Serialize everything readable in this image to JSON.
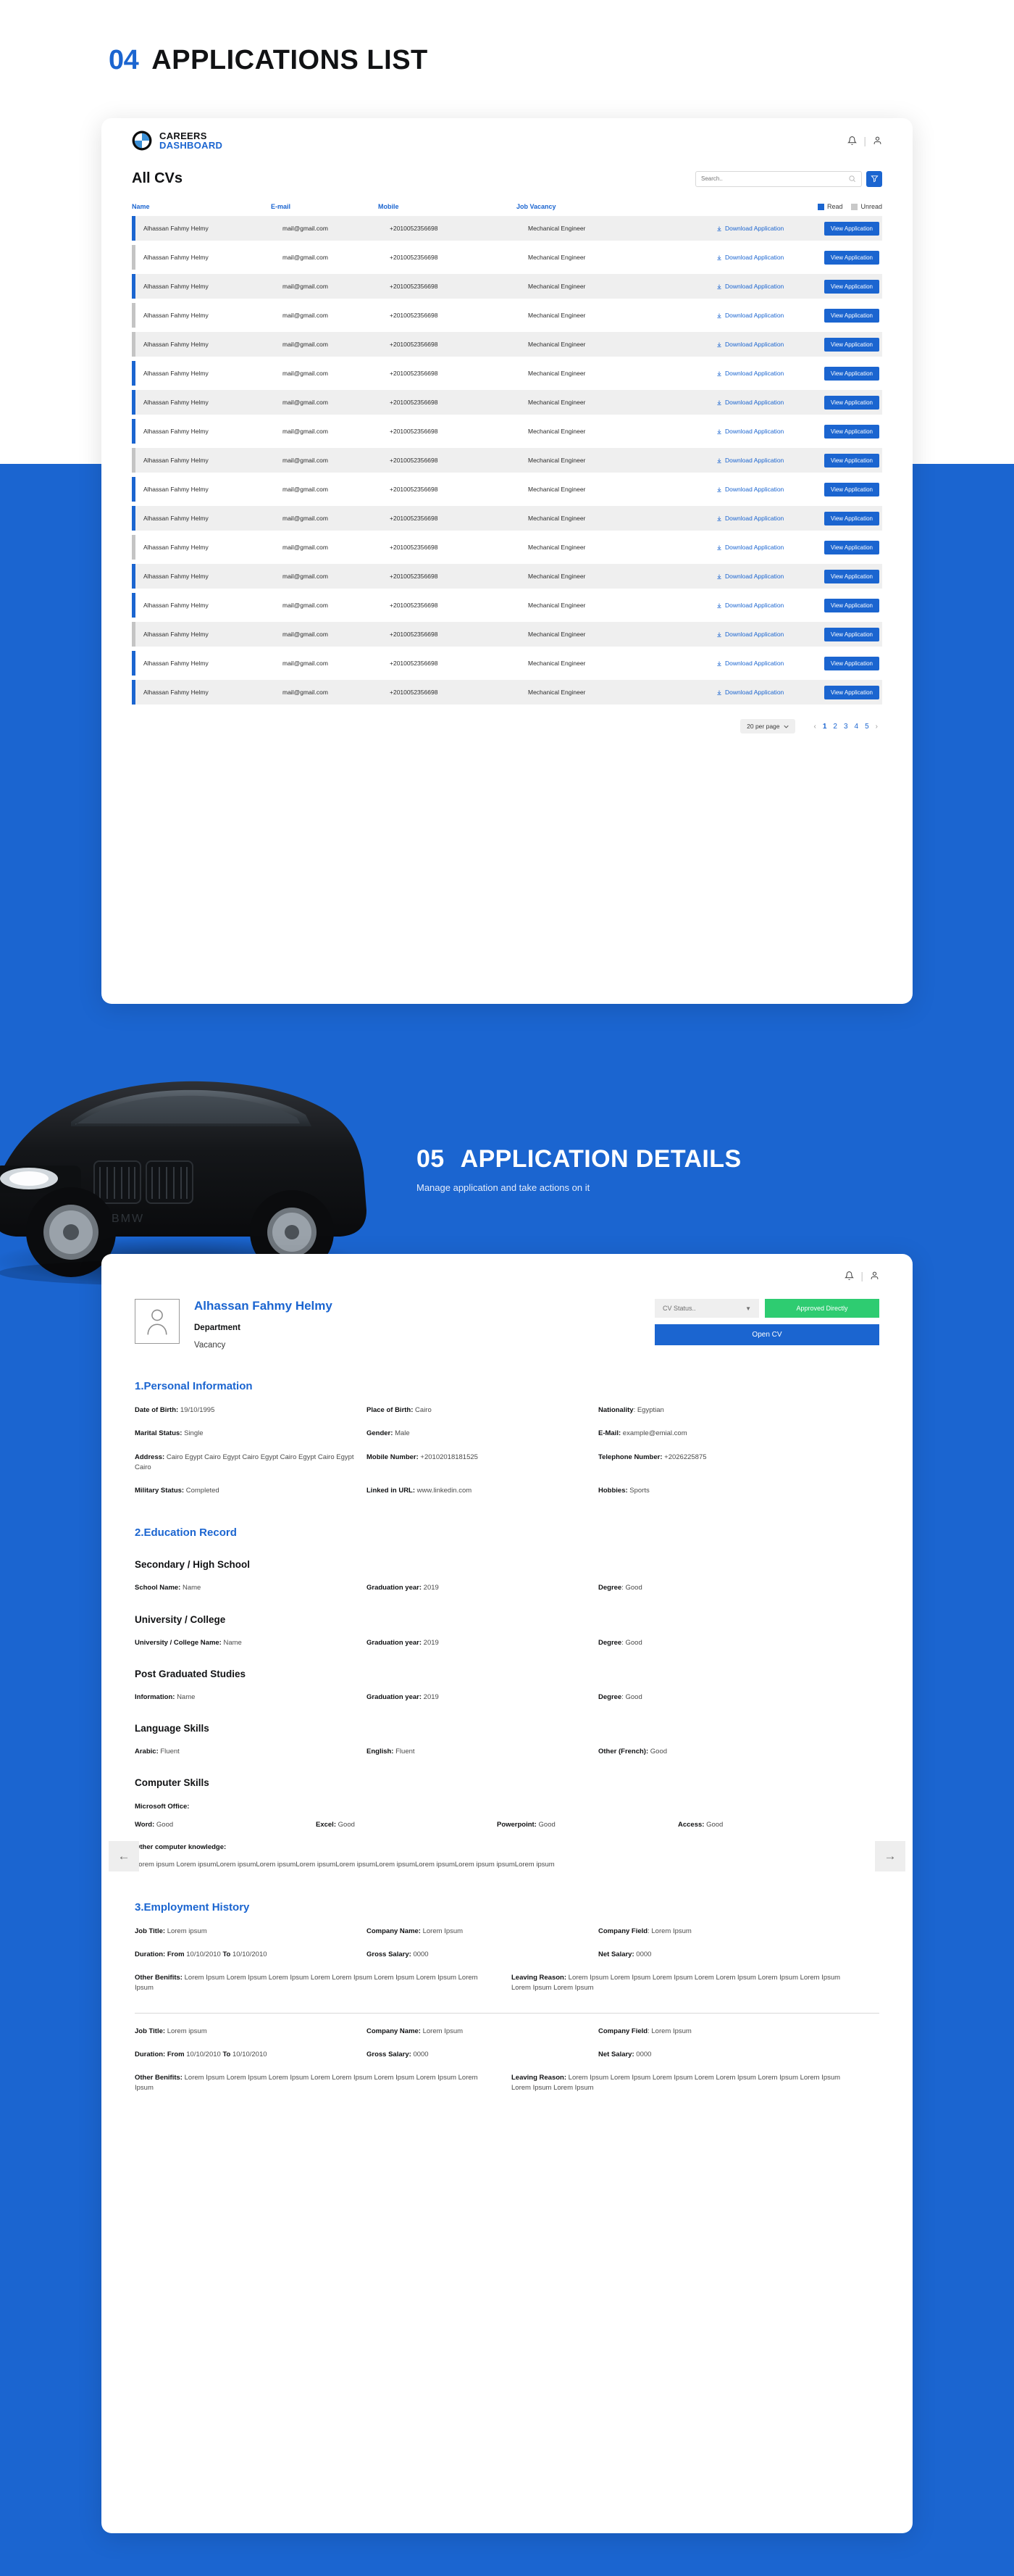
{
  "colors": {
    "brand_blue": "#1B65D0",
    "green": "#2ECC71",
    "gray_row": "#efefef",
    "unread": "#c4c4c4"
  },
  "section04": {
    "number": "04",
    "title": "APPLICATIONS LIST"
  },
  "dashboard": {
    "brand": {
      "careers": "CAREERS",
      "dashboard": "DASHBOARD"
    },
    "icons": {
      "bell": "bell-icon",
      "user": "user-icon"
    },
    "list_title": "All CVs",
    "search": {
      "placeholder": "Search..",
      "value": ""
    },
    "filter_label": "filter-icon",
    "columns": [
      "Name",
      "E-mail",
      "Mobile",
      "Job Vacancy"
    ],
    "legend": {
      "read": "Read",
      "unread": "Unread"
    },
    "row_actions": {
      "download": "Download Application",
      "view": "View Application"
    },
    "rows": [
      {
        "name": "Alhassan Fahmy Helmy",
        "email": "mail@gmail.com",
        "mobile": "+2010052356698",
        "vacancy": "Mechanical Engineer",
        "state": "read",
        "shade": "alt"
      },
      {
        "name": "Alhassan Fahmy Helmy",
        "email": "mail@gmail.com",
        "mobile": "+2010052356698",
        "vacancy": "Mechanical Engineer",
        "state": "unread",
        "shade": "plain"
      },
      {
        "name": "Alhassan Fahmy Helmy",
        "email": "mail@gmail.com",
        "mobile": "+2010052356698",
        "vacancy": "Mechanical Engineer",
        "state": "read",
        "shade": "alt"
      },
      {
        "name": "Alhassan Fahmy Helmy",
        "email": "mail@gmail.com",
        "mobile": "+2010052356698",
        "vacancy": "Mechanical Engineer",
        "state": "unread",
        "shade": "plain"
      },
      {
        "name": "Alhassan Fahmy Helmy",
        "email": "mail@gmail.com",
        "mobile": "+2010052356698",
        "vacancy": "Mechanical Engineer",
        "state": "unread",
        "shade": "alt"
      },
      {
        "name": "Alhassan Fahmy Helmy",
        "email": "mail@gmail.com",
        "mobile": "+2010052356698",
        "vacancy": "Mechanical Engineer",
        "state": "read",
        "shade": "plain"
      },
      {
        "name": "Alhassan Fahmy Helmy",
        "email": "mail@gmail.com",
        "mobile": "+2010052356698",
        "vacancy": "Mechanical Engineer",
        "state": "read",
        "shade": "alt"
      },
      {
        "name": "Alhassan Fahmy Helmy",
        "email": "mail@gmail.com",
        "mobile": "+2010052356698",
        "vacancy": "Mechanical Engineer",
        "state": "read",
        "shade": "plain"
      },
      {
        "name": "Alhassan Fahmy Helmy",
        "email": "mail@gmail.com",
        "mobile": "+2010052356698",
        "vacancy": "Mechanical Engineer",
        "state": "unread",
        "shade": "alt"
      },
      {
        "name": "Alhassan Fahmy Helmy",
        "email": "mail@gmail.com",
        "mobile": "+2010052356698",
        "vacancy": "Mechanical Engineer",
        "state": "read",
        "shade": "plain"
      },
      {
        "name": "Alhassan Fahmy Helmy",
        "email": "mail@gmail.com",
        "mobile": "+2010052356698",
        "vacancy": "Mechanical Engineer",
        "state": "read",
        "shade": "alt"
      },
      {
        "name": "Alhassan Fahmy Helmy",
        "email": "mail@gmail.com",
        "mobile": "+2010052356698",
        "vacancy": "Mechanical Engineer",
        "state": "unread",
        "shade": "plain"
      },
      {
        "name": "Alhassan Fahmy Helmy",
        "email": "mail@gmail.com",
        "mobile": "+2010052356698",
        "vacancy": "Mechanical Engineer",
        "state": "read",
        "shade": "alt"
      },
      {
        "name": "Alhassan Fahmy Helmy",
        "email": "mail@gmail.com",
        "mobile": "+2010052356698",
        "vacancy": "Mechanical Engineer",
        "state": "read",
        "shade": "plain"
      },
      {
        "name": "Alhassan Fahmy Helmy",
        "email": "mail@gmail.com",
        "mobile": "+2010052356698",
        "vacancy": "Mechanical Engineer",
        "state": "unread",
        "shade": "alt"
      },
      {
        "name": "Alhassan Fahmy Helmy",
        "email": "mail@gmail.com",
        "mobile": "+2010052356698",
        "vacancy": "Mechanical Engineer",
        "state": "read",
        "shade": "plain"
      },
      {
        "name": "Alhassan Fahmy Helmy",
        "email": "mail@gmail.com",
        "mobile": "+2010052356698",
        "vacancy": "Mechanical Engineer",
        "state": "read",
        "shade": "alt"
      }
    ],
    "pagination": {
      "per_page": "20 per page",
      "prev": "‹",
      "next": "›",
      "pages": [
        "1",
        "2",
        "3",
        "4",
        "5"
      ],
      "current": "1"
    }
  },
  "section05": {
    "number": "05",
    "title": "APPLICATION DETAILS",
    "subtitle": "Manage application and take actions on it"
  },
  "details": {
    "icons": {
      "bell": "bell-icon",
      "user": "user-icon"
    },
    "candidate_name": "Alhassan Fahmy Helmy",
    "department_label": "Department",
    "vacancy_label": "Vacancy",
    "cv_status": "CV Status..",
    "approve_button": "Approved Directly",
    "open_cv_button": "Open CV",
    "nav": {
      "prev": "←",
      "next": "→"
    },
    "personal": {
      "title": "1.Personal Information",
      "fields": [
        {
          "k": "Date of Birth:",
          "v": "19/10/1995"
        },
        {
          "k": "Place of Birth:",
          "v": "Cairo"
        },
        {
          "k": "Nationality",
          "v": ": Egyptian"
        },
        {
          "k": "Marital Status:",
          "v": "Single"
        },
        {
          "k": "Gender:",
          "v": "Male"
        },
        {
          "k": "E-Mail:",
          "v": "example@emial.com"
        },
        {
          "k": "Address:",
          "v": "Cairo Egypt Cairo Egypt Cairo Egypt Cairo Egypt Cairo Egypt Cairo"
        },
        {
          "k": "Mobile Number:",
          "v": "+20102018181525"
        },
        {
          "k": "Telephone Number:",
          "v": "+2026225875"
        },
        {
          "k": "Military Status:",
          "v": "Completed"
        },
        {
          "k": "Linked in URL:",
          "v": "www.linkedin.com"
        },
        {
          "k": "Hobbies:",
          "v": "Sports"
        }
      ]
    },
    "education": {
      "title": "2.Education Record",
      "blocks": [
        {
          "heading": "Secondary / High School",
          "fields": [
            {
              "k": "School Name:",
              "v": "Name"
            },
            {
              "k": "Graduation year:",
              "v": "2019"
            },
            {
              "k": "Degree",
              "v": ": Good"
            }
          ]
        },
        {
          "heading": "University / College",
          "fields": [
            {
              "k": "University / College Name:",
              "v": "Name"
            },
            {
              "k": "Graduation year:",
              "v": "2019"
            },
            {
              "k": "Degree",
              "v": ": Good"
            }
          ]
        },
        {
          "heading": "Post Graduated Studies",
          "fields": [
            {
              "k": "Information:",
              "v": "Name"
            },
            {
              "k": "Graduation year:",
              "v": "2019"
            },
            {
              "k": "Degree",
              "v": ": Good"
            }
          ]
        }
      ],
      "language": {
        "heading": "Language Skills",
        "fields": [
          {
            "k": "Arabic:",
            "v": "Fluent"
          },
          {
            "k": "English:",
            "v": "Fluent"
          },
          {
            "k": "Other (French):",
            "v": "Good"
          }
        ]
      },
      "computer": {
        "heading": "Computer Skills",
        "office_label": "Microsoft Office:",
        "office": [
          {
            "k": "Word:",
            "v": "Good"
          },
          {
            "k": "Excel:",
            "v": "Good"
          },
          {
            "k": "Powerpoint:",
            "v": "Good"
          },
          {
            "k": "Access:",
            "v": "Good"
          }
        ],
        "other_label": "Other computer knowledge:",
        "other_text": "Lorem ipsum Lorem ipsumLorem ipsumLorem ipsumLorem ipsumLorem ipsumLorem ipsumLorem ipsumLorem ipsum ipsumLorem ipsum"
      }
    },
    "employment": {
      "title": "3.Employment History",
      "entries": [
        {
          "job_title": {
            "k": "Job Title:",
            "v": "Lorem ipsum"
          },
          "company_name": {
            "k": "Company Name:",
            "v": "Lorem Ipsum"
          },
          "company_field": {
            "k": "Company Field",
            "v": ": Lorem Ipsum"
          },
          "duration": {
            "k": "Duration: From",
            "v": "10/10/2010",
            "k2": "To",
            "v2": "10/10/2010"
          },
          "gross": {
            "k": "Gross Salary:",
            "v": "0000"
          },
          "net": {
            "k": "Net Salary:",
            "v": "0000"
          },
          "benefits": {
            "k": "Other Benifits:",
            "v": "Lorem Ipsum Lorem Ipsum Lorem Ipsum Lorem Lorem Ipsum Lorem Ipsum Lorem Ipsum Lorem Ipsum"
          },
          "leaving": {
            "k": "Leaving Reason:",
            "v": "Lorem Ipsum Lorem Ipsum Lorem Ipsum Lorem Lorem Ipsum Lorem Ipsum Lorem Ipsum Lorem Ipsum Lorem Ipsum"
          }
        },
        {
          "job_title": {
            "k": "Job Title:",
            "v": "Lorem ipsum"
          },
          "company_name": {
            "k": "Company Name:",
            "v": "Lorem Ipsum"
          },
          "company_field": {
            "k": "Company Field",
            "v": ": Lorem Ipsum"
          },
          "duration": {
            "k": "Duration: From",
            "v": "10/10/2010",
            "k2": "To",
            "v2": "10/10/2010"
          },
          "gross": {
            "k": "Gross Salary:",
            "v": "0000"
          },
          "net": {
            "k": "Net Salary:",
            "v": "0000"
          },
          "benefits": {
            "k": "Other Benifits:",
            "v": "Lorem Ipsum Lorem Ipsum Lorem Ipsum Lorem Lorem Ipsum Lorem Ipsum Lorem Ipsum Lorem Ipsum"
          },
          "leaving": {
            "k": "Leaving Reason:",
            "v": "Lorem Ipsum Lorem Ipsum Lorem Ipsum Lorem Lorem Ipsum Lorem Ipsum Lorem Ipsum Lorem Ipsum Lorem Ipsum"
          }
        }
      ]
    }
  }
}
